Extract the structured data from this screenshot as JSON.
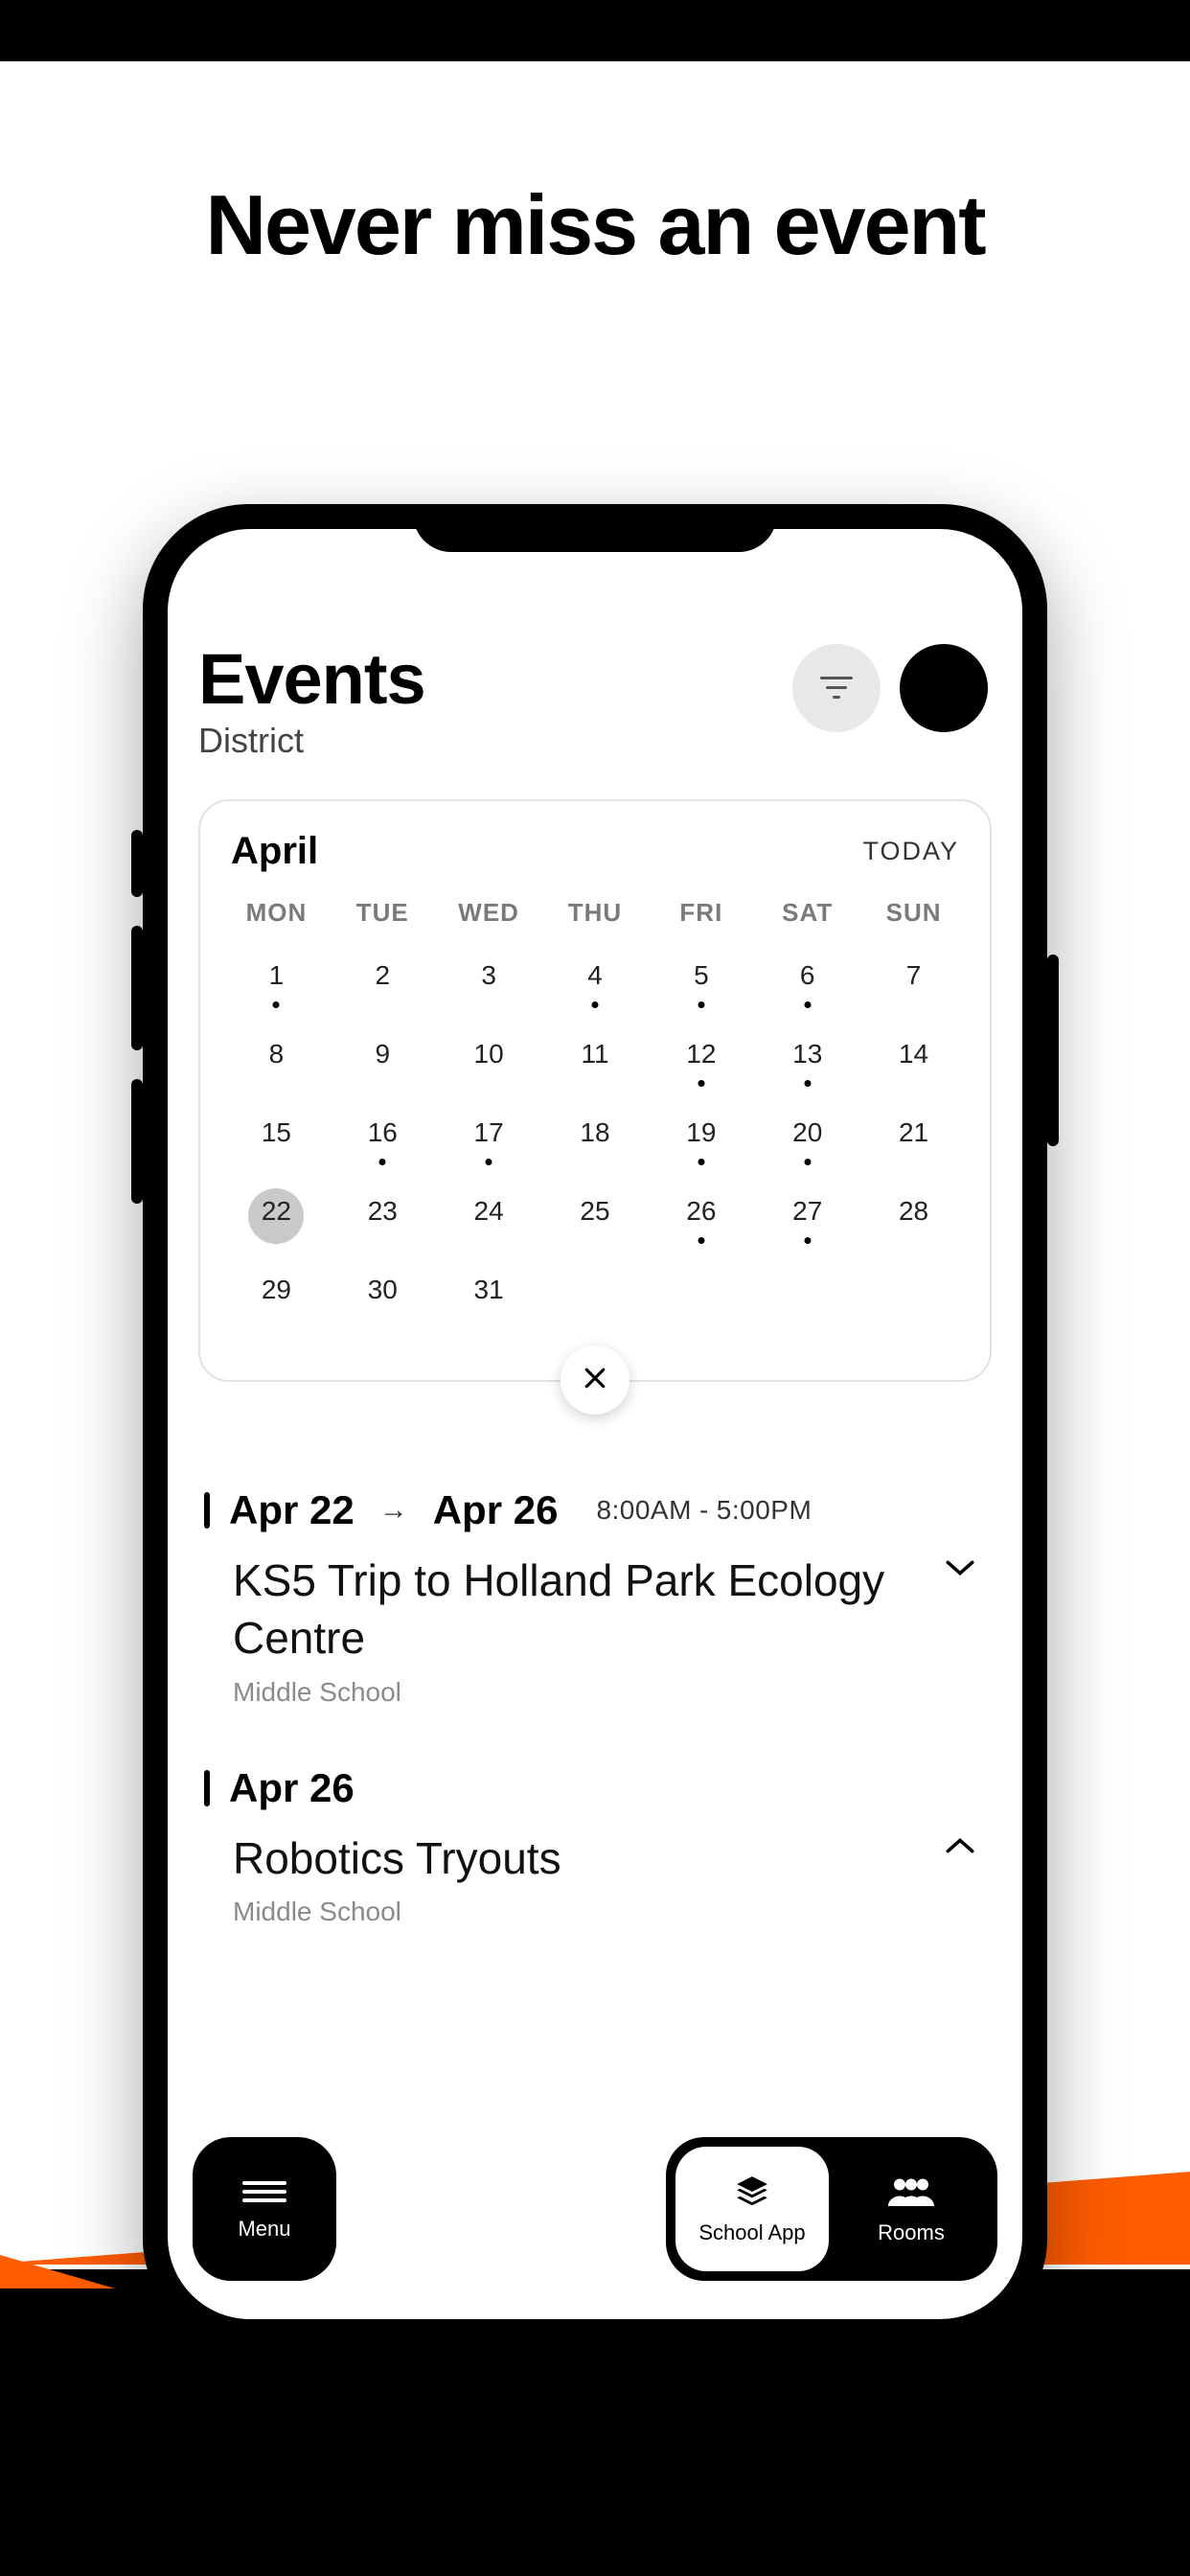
{
  "promo": {
    "headline": "Never miss an event"
  },
  "header": {
    "title": "Events",
    "subtitle": "District"
  },
  "calendar": {
    "month": "April",
    "today_label": "TODAY",
    "day_headers": [
      "MON",
      "TUE",
      "WED",
      "THU",
      "FRI",
      "SAT",
      "SUN"
    ],
    "days": [
      {
        "n": 1,
        "dot": true
      },
      {
        "n": 2
      },
      {
        "n": 3
      },
      {
        "n": 4,
        "dot": true
      },
      {
        "n": 5,
        "dot": true
      },
      {
        "n": 6,
        "dot": true
      },
      {
        "n": 7
      },
      {
        "n": 8
      },
      {
        "n": 9
      },
      {
        "n": 10
      },
      {
        "n": 11
      },
      {
        "n": 12,
        "dot": true
      },
      {
        "n": 13,
        "dot": true
      },
      {
        "n": 14
      },
      {
        "n": 15
      },
      {
        "n": 16,
        "dot": true
      },
      {
        "n": 17,
        "dot": true
      },
      {
        "n": 18
      },
      {
        "n": 19,
        "dot": true
      },
      {
        "n": 20,
        "dot": true
      },
      {
        "n": 21
      },
      {
        "n": 22,
        "dot": true,
        "selected": true
      },
      {
        "n": 23
      },
      {
        "n": 24
      },
      {
        "n": 25
      },
      {
        "n": 26,
        "dot": true
      },
      {
        "n": 27,
        "dot": true
      },
      {
        "n": 28
      },
      {
        "n": 29
      },
      {
        "n": 30
      },
      {
        "n": 31
      }
    ]
  },
  "events": [
    {
      "date_start": "Apr 22",
      "date_end": "Apr 26",
      "time_start": "8:00AM",
      "time_end": "5:00PM",
      "title": "KS5 Trip to Holland Park Ecology Centre",
      "location": "Middle School",
      "expanded": false
    },
    {
      "date_start": "Apr 26",
      "title": "Robotics Tryouts",
      "location": "Middle School",
      "expanded": true
    }
  ],
  "bottom": {
    "menu": "Menu",
    "tabs": [
      {
        "label": "School App",
        "active": true
      },
      {
        "label": "Rooms",
        "active": false
      }
    ]
  }
}
